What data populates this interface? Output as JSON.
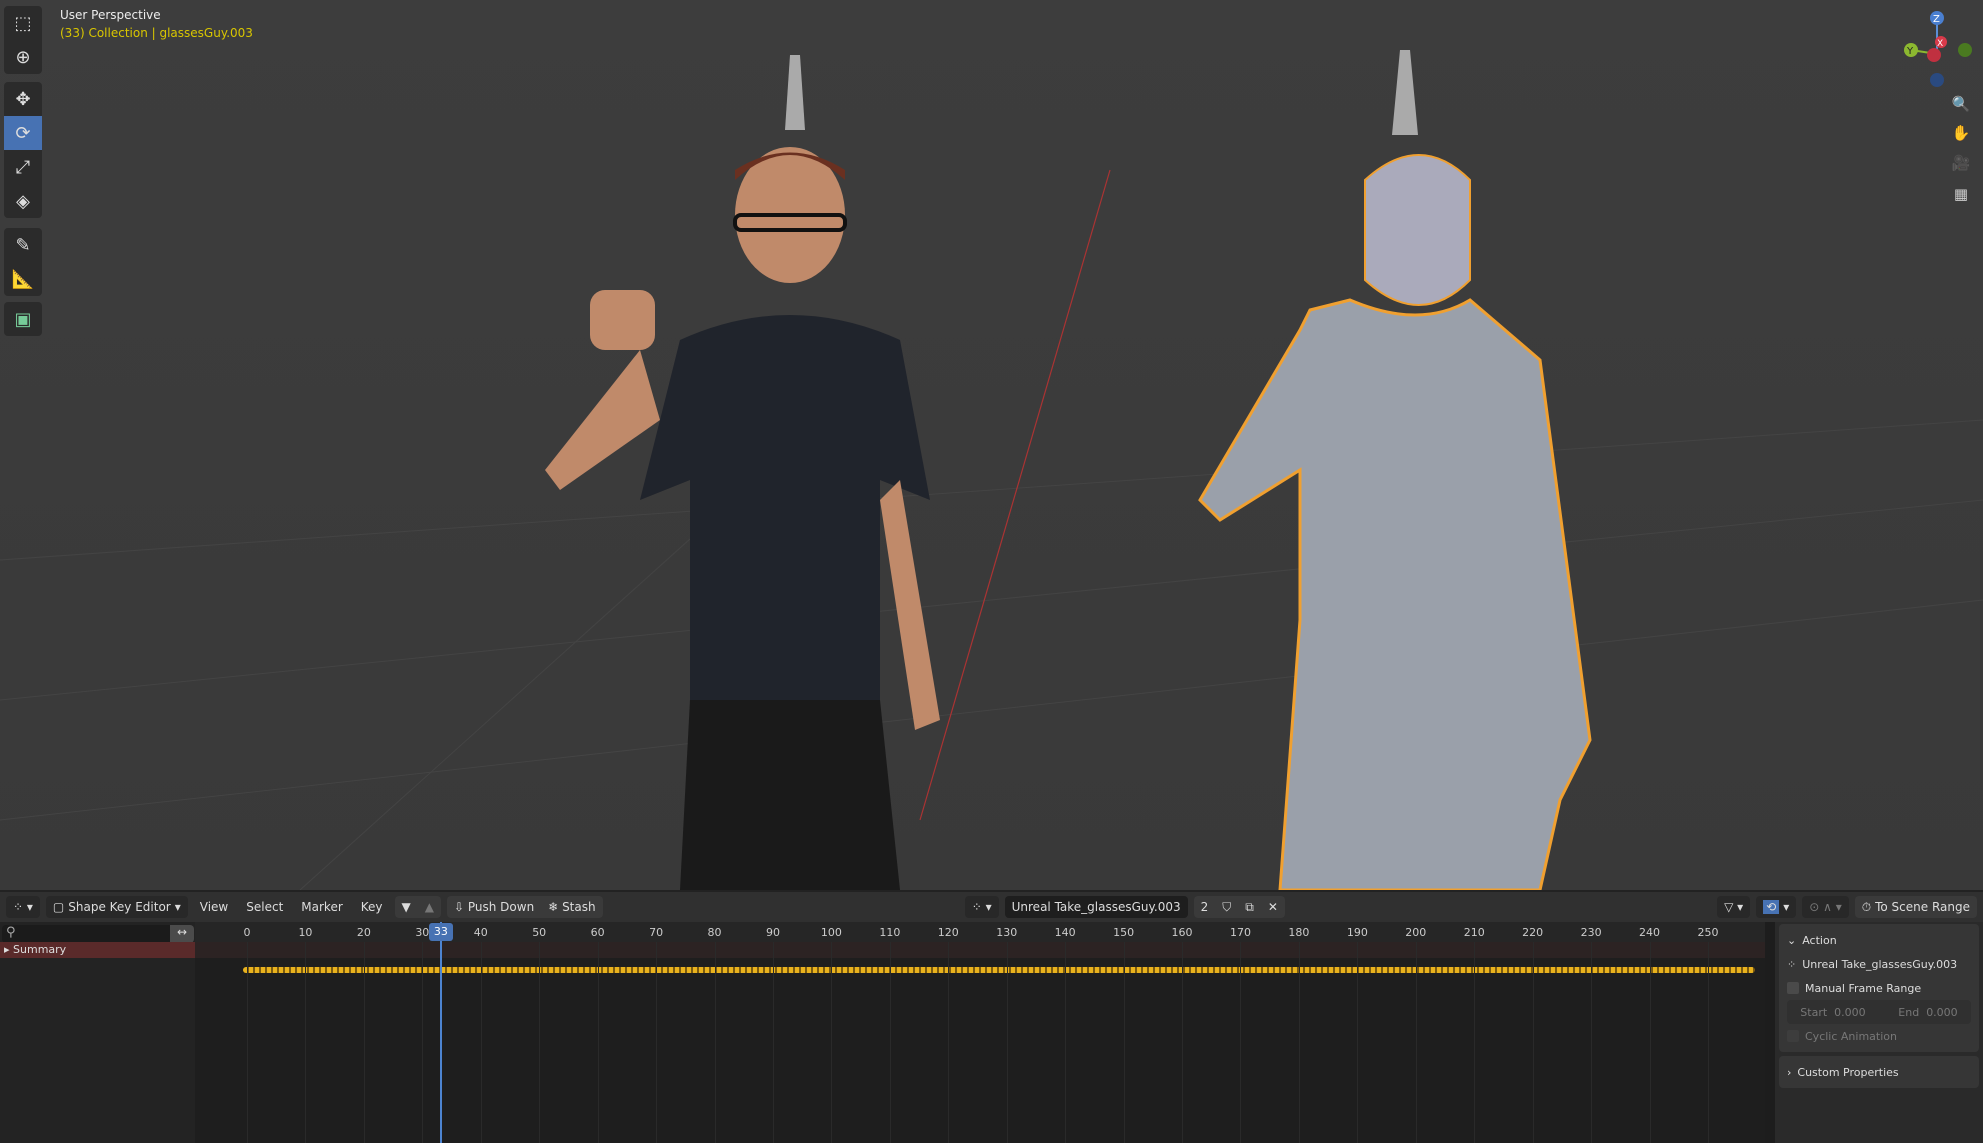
{
  "viewport": {
    "title": "User Perspective",
    "subtitle": "(33) Collection | glassesGuy.003",
    "tools": [
      "select-box",
      "cursor",
      "move",
      "rotate",
      "scale",
      "transform",
      "annotate",
      "measure",
      "add-cube"
    ],
    "active_tool": "rotate",
    "axes": {
      "z": "Z",
      "y": "Y",
      "x": "X"
    }
  },
  "header": {
    "editor": "Shape Key Editor",
    "menus": [
      "View",
      "Select",
      "Marker",
      "Key"
    ],
    "push_down": "Push Down",
    "stash": "Stash",
    "action_name": "Unreal Take_glassesGuy.003",
    "users": "2",
    "to_scene_range": "To Scene Range"
  },
  "timeline": {
    "current_frame": "33",
    "frame_min": 0,
    "frame_max": 250,
    "ticks": [
      "0",
      "10",
      "20",
      "30",
      "40",
      "50",
      "60",
      "70",
      "80",
      "90",
      "100",
      "110",
      "120",
      "130",
      "140",
      "150",
      "160",
      "170",
      "180",
      "190",
      "200",
      "210",
      "220",
      "230",
      "240",
      "250"
    ],
    "channel": "Summary"
  },
  "panel": {
    "action_header": "Action",
    "action_name": "Unreal Take_glassesGuy.003",
    "manual_frame_range": "Manual Frame Range",
    "start_label": "Start",
    "start_value": "0.000",
    "end_label": "End",
    "end_value": "0.000",
    "cyclic": "Cyclic Animation",
    "custom_props": "Custom Properties"
  },
  "colors": {
    "accent": "#4772b3",
    "keyframe": "#e8b21e",
    "selection": "#f0a030"
  }
}
